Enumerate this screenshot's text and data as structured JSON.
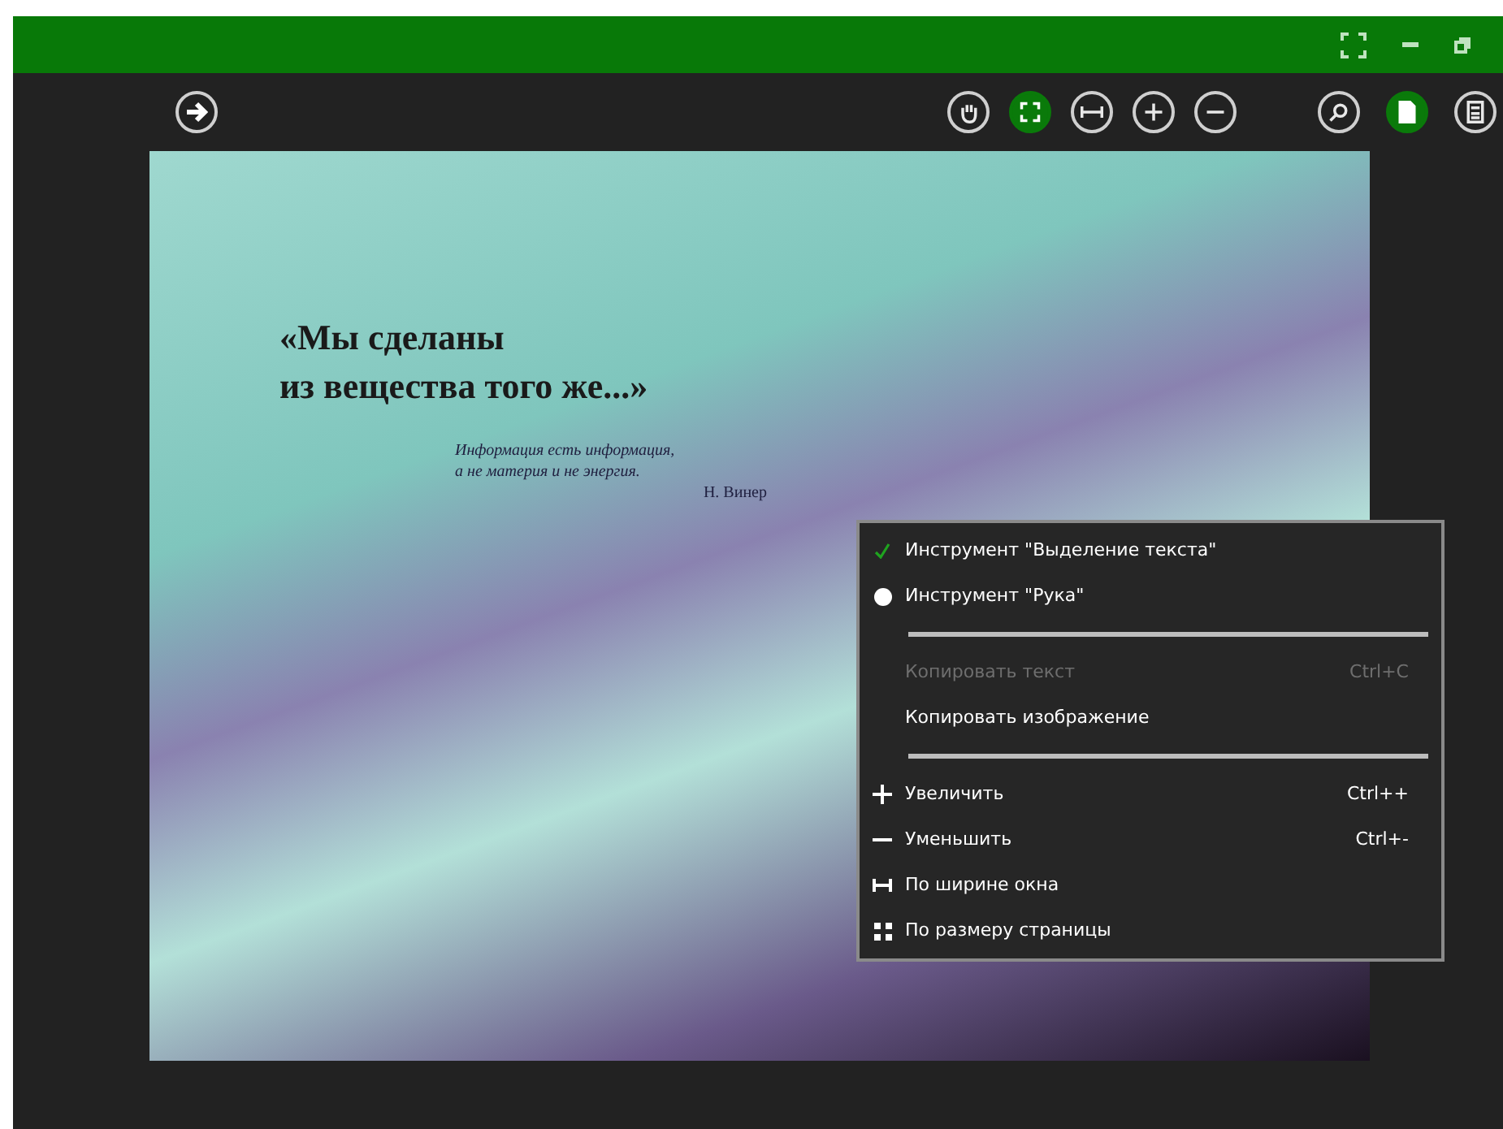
{
  "toolbar": {
    "tools": [
      {
        "kind": "hand",
        "selected": false
      },
      {
        "kind": "fit-page",
        "selected": true
      },
      {
        "kind": "fit-width",
        "selected": false
      },
      {
        "kind": "zoom-in",
        "selected": false
      },
      {
        "kind": "zoom-out",
        "selected": false
      }
    ],
    "views": [
      {
        "kind": "search",
        "selected": false
      },
      {
        "kind": "page",
        "selected": true
      },
      {
        "kind": "layout",
        "selected": false
      }
    ]
  },
  "scan": {
    "headline": [
      "«Мы сделаны",
      "из вещества того же...»"
    ],
    "epigraph": [
      "Информация есть информация,",
      "а не материя и не энергия."
    ],
    "author": "Н. Винер"
  },
  "context_menu": {
    "items": [
      {
        "kind": "check",
        "label": "Инструмент \"Выделение текста\"",
        "checked": true
      },
      {
        "kind": "radio",
        "label": "Инструмент \"Рука\"",
        "checked": true
      },
      {
        "kind": "separator"
      },
      {
        "kind": "command",
        "label": "Копировать текст",
        "shortcut": "Ctrl+C",
        "disabled": true
      },
      {
        "kind": "command",
        "label": "Копировать изображение",
        "disabled": false
      },
      {
        "kind": "separator"
      },
      {
        "kind": "zoom-in",
        "label": "Увеличить",
        "shortcut": "Ctrl++",
        "disabled": false
      },
      {
        "kind": "zoom-out",
        "label": "Уменьшить",
        "shortcut": "Ctrl+-",
        "disabled": false
      },
      {
        "kind": "fit-width",
        "label": "По ширине окна",
        "disabled": false
      },
      {
        "kind": "fit-page",
        "label": "По размеру страницы",
        "disabled": false
      }
    ]
  }
}
